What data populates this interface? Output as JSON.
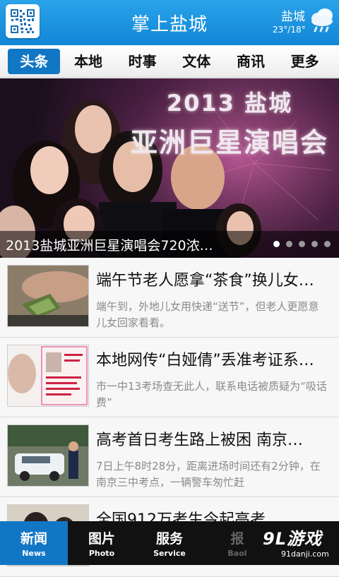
{
  "header": {
    "title": "掌上盐城",
    "weather": {
      "city": "盐城",
      "temperature": "23°/18°",
      "icon": "cloud-rain-icon"
    },
    "qr_icon": "qr-code-icon"
  },
  "tabs": [
    {
      "label": "头条",
      "active": true
    },
    {
      "label": "本地",
      "active": false
    },
    {
      "label": "时事",
      "active": false
    },
    {
      "label": "文体",
      "active": false
    },
    {
      "label": "商讯",
      "active": false
    },
    {
      "label": "更多",
      "active": false
    }
  ],
  "banner": {
    "headline_line1": "2013 盐城",
    "headline_line2": "亚洲巨星演唱会",
    "caption": "2013盐城亚洲巨星演唱会720浓…",
    "slide_count": 5,
    "active_slide": 1
  },
  "news": [
    {
      "title": "端午节老人愿拿“茶食”换儿女…",
      "summary": "端午到，外地儿女用快递“送节”，但老人更愿意儿女回家看看。"
    },
    {
      "title": "本地网传“白娅倩”丢准考证系…",
      "summary": "市一中13考场查无此人，联系电话被质疑为“吸话费”"
    },
    {
      "title": "高考首日考生路上被困 南京…",
      "summary": "7日上午8时28分，距离进场时间还有2分钟，在南京三中考点，一辆警车匆忙赶"
    },
    {
      "title": "全国912万考生今起高考",
      "summary": ""
    }
  ],
  "bottom_nav": [
    {
      "cn": "新闻",
      "en": "News",
      "active": true
    },
    {
      "cn": "图片",
      "en": "Photo",
      "active": false
    },
    {
      "cn": "服务",
      "en": "Service",
      "active": false
    },
    {
      "cn": "报",
      "en": "Baol",
      "active": false
    }
  ],
  "watermark": {
    "main": "9L游戏",
    "sub": "91danji.com"
  },
  "colors": {
    "header_blue": "#1a93e0",
    "accent_blue": "#1177c5",
    "nav_bg": "#111111"
  }
}
